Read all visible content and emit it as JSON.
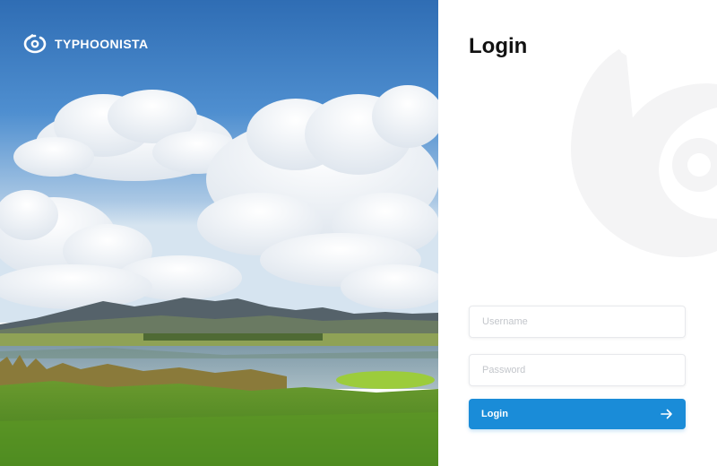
{
  "brand": {
    "name": "TYPHOONISTA",
    "logo_icon": "typhoon-logo-icon"
  },
  "login": {
    "title": "Login",
    "username_placeholder": "Username",
    "password_placeholder": "Password",
    "button_label": "Login",
    "button_icon": "arrow-right-icon"
  },
  "colors": {
    "accent": "#1a8cd8",
    "watermark": "#f4f4f5",
    "sky": "#3a7ec4"
  }
}
